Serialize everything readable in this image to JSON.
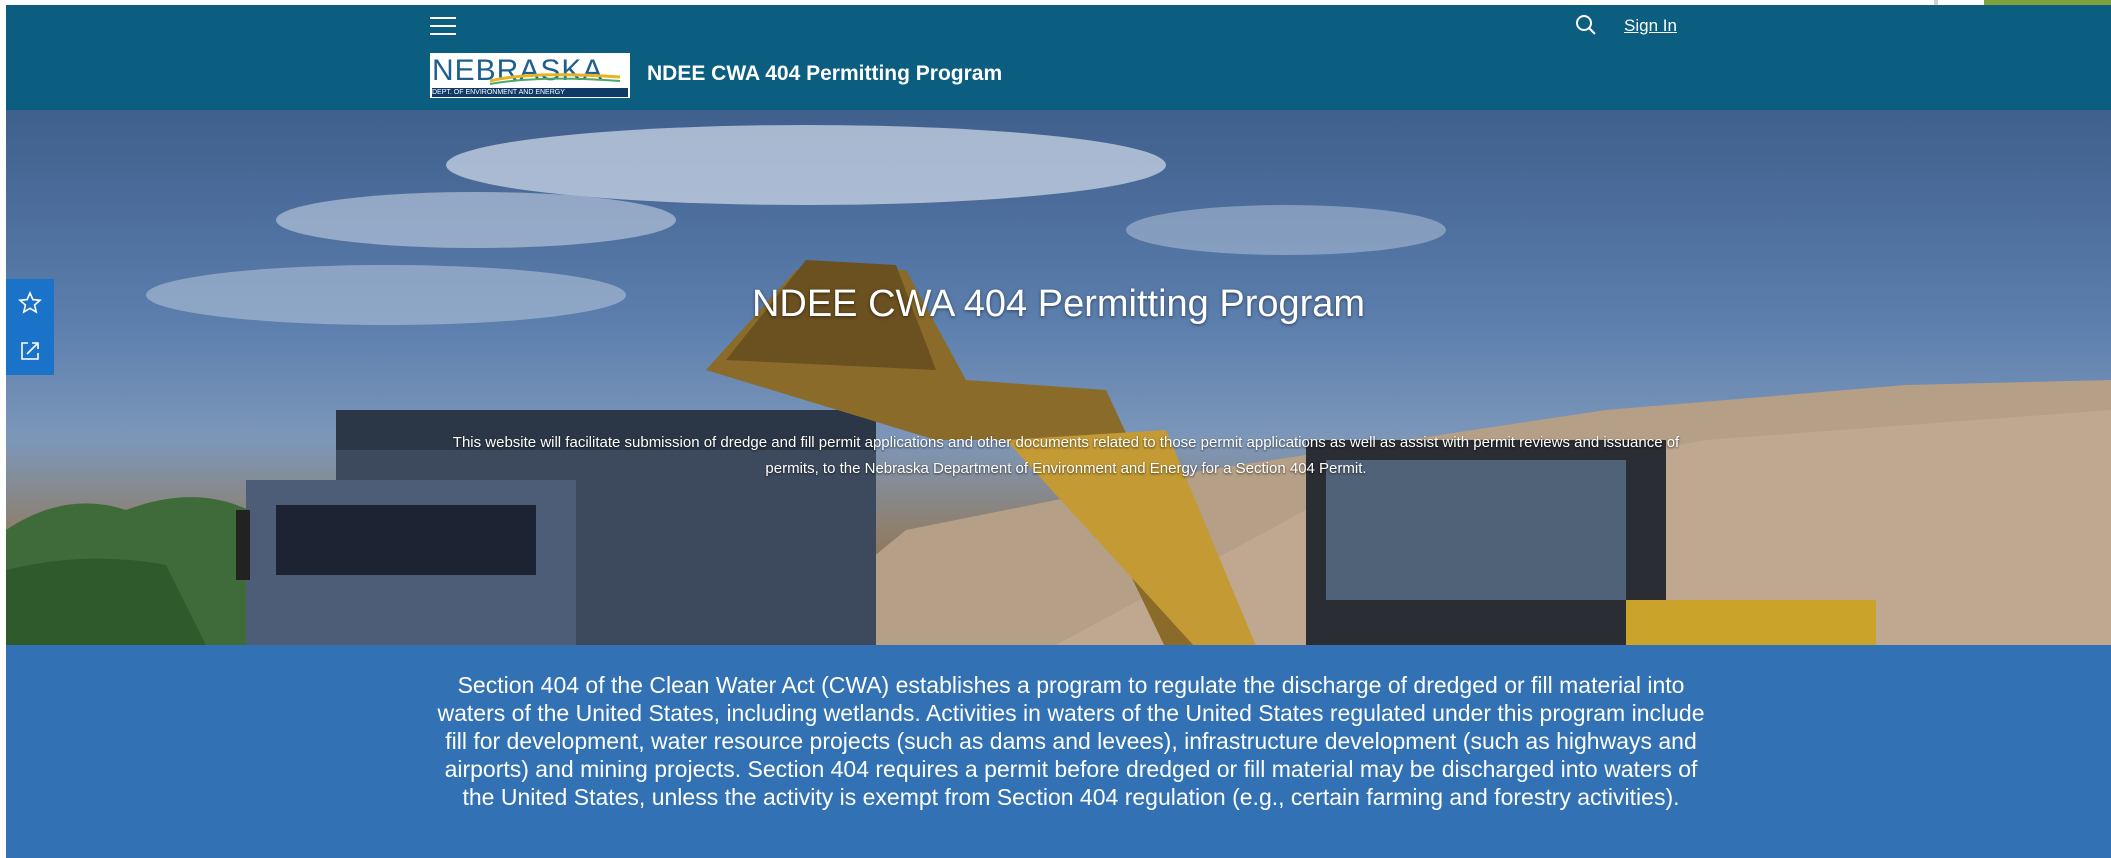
{
  "header": {
    "menu_icon": "hamburger-menu-icon",
    "search_icon": "search-icon",
    "sign_in_label": "Sign In",
    "logo_text": "NEBRASKA",
    "logo_subtext": "DEPT. OF ENVIRONMENT AND ENERGY",
    "site_title": "NDEE CWA 404 Permitting Program"
  },
  "hero": {
    "title": "NDEE CWA 404 Permitting Program",
    "description": "This website will facilitate submission of dredge and fill permit applications and other documents related to those permit applications as well as assist with permit reviews and issuance of permits, to the Nebraska Department of Environment and Energy for a Section 404 Permit."
  },
  "side_actions": {
    "favorite_icon": "star-icon",
    "share_icon": "share-icon"
  },
  "info": {
    "text": "Section 404 of the Clean Water Act (CWA) establishes a program to regulate the discharge of dredged or fill material into waters of the United States, including wetlands. Activities in waters of the United States regulated under this program include fill for development, water resource projects (such as dams and levees), infrastructure development (such as highways and airports) and mining projects. Section 404 requires a permit before dredged or fill material may be discharged into waters of the United States, unless the activity is exempt from Section 404 regulation (e.g., certain farming and forestry activities)."
  },
  "colors": {
    "header_bg": "#0b5e80",
    "info_bg": "#3272b4",
    "side_bar_bg": "#1a73c9"
  }
}
